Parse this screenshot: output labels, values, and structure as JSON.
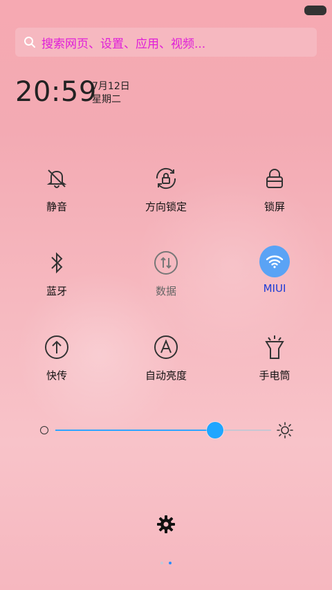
{
  "status_bar": {
    "battery_icon": "battery-icon"
  },
  "search": {
    "placeholder": "搜索网页、设置、应用、视频..."
  },
  "clock": {
    "time": "20:59",
    "date": "7月12日",
    "weekday": "星期二"
  },
  "toggles": [
    {
      "label": "静音",
      "icon": "mute-bell-icon",
      "state": "off"
    },
    {
      "label": "方向锁定",
      "icon": "rotation-lock-icon",
      "state": "off"
    },
    {
      "label": "锁屏",
      "icon": "lock-icon",
      "state": "off"
    },
    {
      "label": "蓝牙",
      "icon": "bluetooth-icon",
      "state": "off"
    },
    {
      "label": "数据",
      "icon": "mobile-data-icon",
      "state": "disabled"
    },
    {
      "label": "MIUI",
      "icon": "wifi-icon",
      "state": "on"
    },
    {
      "label": "快传",
      "icon": "share-upload-icon",
      "state": "off"
    },
    {
      "label": "自动亮度",
      "icon": "auto-brightness-icon",
      "state": "off"
    },
    {
      "label": "手电筒",
      "icon": "flashlight-icon",
      "state": "off"
    }
  ],
  "brightness": {
    "level": 0.74
  },
  "colors": {
    "accent": "#2ea5ff",
    "search_text": "#e01ed8",
    "active_label": "#1b3bd6"
  },
  "settings": {
    "icon": "gear-icon"
  },
  "pager": {
    "pages": 2,
    "current": 2
  }
}
